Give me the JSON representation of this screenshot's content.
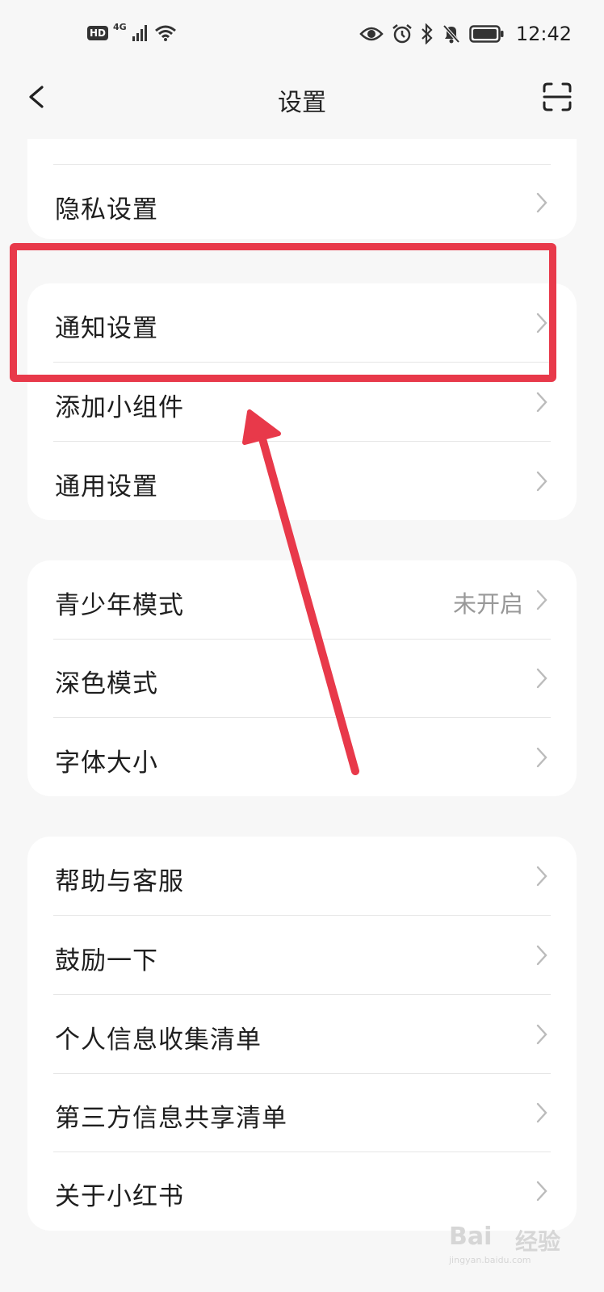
{
  "status_bar": {
    "hd": "HD",
    "network": "4G",
    "time": "12:42",
    "icons": [
      "hd-badge",
      "signal-icon",
      "wifi-icon",
      "eye-icon",
      "alarm-icon",
      "bluetooth-icon",
      "mute-bell-icon",
      "battery-icon"
    ]
  },
  "nav": {
    "title": "设置",
    "back_icon": "chevron-left-icon",
    "scan_icon": "scan-icon"
  },
  "groups": [
    {
      "items": [
        {
          "label": "隐私设置"
        }
      ]
    },
    {
      "items": [
        {
          "label": "通知设置"
        },
        {
          "label": "添加小组件"
        },
        {
          "label": "通用设置"
        }
      ]
    },
    {
      "items": [
        {
          "label": "青少年模式",
          "value": "未开启"
        },
        {
          "label": "深色模式"
        },
        {
          "label": "字体大小"
        }
      ]
    },
    {
      "items": [
        {
          "label": "帮助与客服"
        },
        {
          "label": "鼓励一下"
        },
        {
          "label": "个人信息收集清单"
        },
        {
          "label": "第三方信息共享清单"
        },
        {
          "label": "关于小红书"
        }
      ]
    }
  ],
  "annotation": {
    "color": "#e8394a"
  },
  "watermark": {
    "logo": "Bai",
    "cn": "经验",
    "url": "jingyan.baidu.com"
  }
}
